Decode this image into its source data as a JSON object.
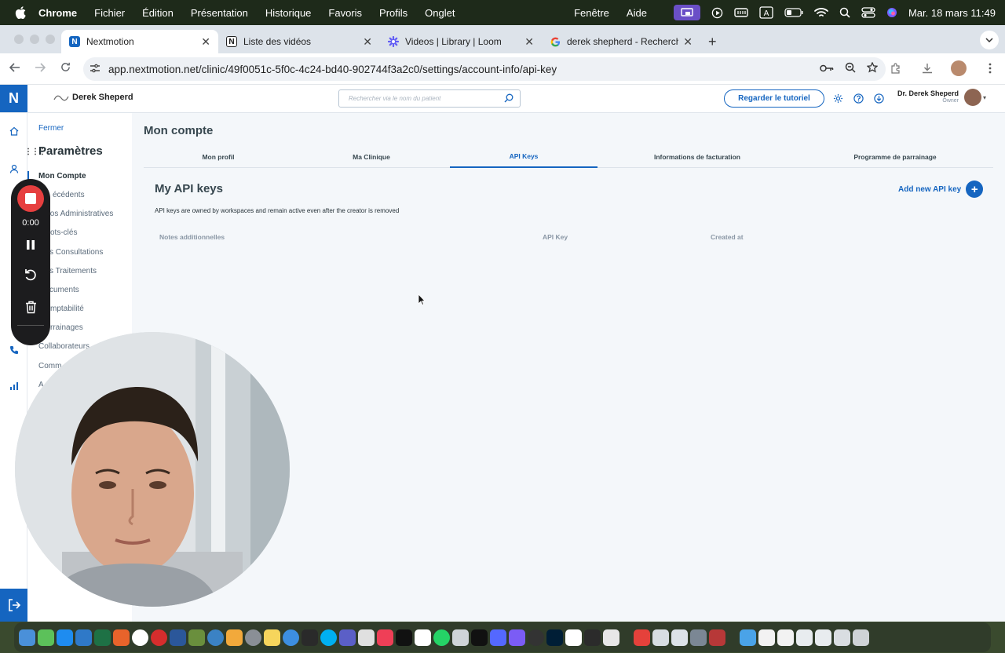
{
  "menubar": {
    "items": [
      "Chrome",
      "Fichier",
      "Édition",
      "Présentation",
      "Historique",
      "Favoris",
      "Profils",
      "Onglet"
    ],
    "right_items": [
      "Fenêtre",
      "Aide"
    ],
    "datetime": "Mar. 18 mars  11:49"
  },
  "browser": {
    "tabs": [
      {
        "title": "Nextmotion",
        "active": true,
        "icon": "nextmotion-icon",
        "color": "#1565c0"
      },
      {
        "title": "Liste des vidéos",
        "active": false,
        "icon": "notion-icon",
        "color": "#111111"
      },
      {
        "title": "Videos | Library | Loom",
        "active": false,
        "icon": "loom-icon",
        "color": "#625df5"
      },
      {
        "title": "derek shepherd - Recherche",
        "active": false,
        "icon": "google-icon",
        "color": "#4285f4"
      }
    ],
    "url": "app.nextmotion.net/clinic/49f0051c-5f0c-4c24-bd40-902744f3a2c0/settings/account-info/api-key"
  },
  "app": {
    "clinic_name": "Derek Sheperd",
    "search_placeholder": "Rechercher via le nom du patient",
    "tutorial_button": "Regarder le tutoriel",
    "user_name": "Dr. Derek Sheperd",
    "user_role": "Owner",
    "accent_color": "#1565c0"
  },
  "settings_nav": {
    "close": "Fermer",
    "title": "Paramètres",
    "items": [
      {
        "label": "Mon Compte",
        "active": true
      },
      {
        "label": "écédents",
        "active": false
      },
      {
        "label": "fos Administratives",
        "active": false
      },
      {
        "label": "ots-clés",
        "active": false
      },
      {
        "label": "s Consultations",
        "active": false
      },
      {
        "label": "s Traitements",
        "active": false
      },
      {
        "label": "cuments",
        "active": false
      },
      {
        "label": "mptabilité",
        "active": false
      },
      {
        "label": "rrainages",
        "active": false
      },
      {
        "label": "Collaborateurs",
        "active": false
      },
      {
        "label": "Comm",
        "active": false
      },
      {
        "label": "A",
        "active": false
      }
    ]
  },
  "main": {
    "page_title": "Mon compte",
    "tabs": [
      {
        "label": "Mon profil",
        "active": false
      },
      {
        "label": "Ma Clinique",
        "active": false
      },
      {
        "label": "API Keys",
        "active": true
      },
      {
        "label": "Informations de facturation",
        "active": false
      },
      {
        "label": "Programme de parrainage",
        "active": false
      }
    ],
    "section_title": "My API keys",
    "description": "API keys are owned by workspaces and remain active even after the creator is removed",
    "add_button": "Add new API key",
    "columns": [
      "Notes additionnelles",
      "API Key",
      "Created at"
    ]
  },
  "recorder": {
    "elapsed": "0:00",
    "stop_color": "#e63f3f"
  }
}
